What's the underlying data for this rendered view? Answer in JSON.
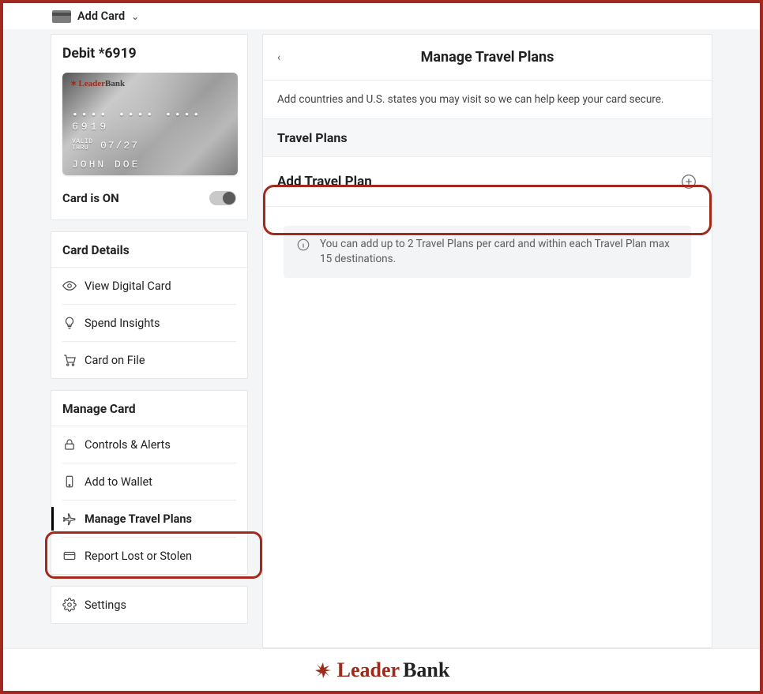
{
  "topbar": {
    "add_card_label": "Add Card"
  },
  "card_summary": {
    "title": "Debit *6919",
    "brand_leader": "Leader",
    "brand_bank": "Bank",
    "pan": "•••• •••• •••• 6919",
    "valid_label_line1": "VALID",
    "valid_label_line2": "THRU",
    "valid_value": "07/27",
    "holder": "JOHN DOE",
    "status_label": "Card is ON"
  },
  "card_details": {
    "heading": "Card Details",
    "items": [
      {
        "label": "View Digital Card",
        "icon": "eye-icon"
      },
      {
        "label": "Spend Insights",
        "icon": "bulb-icon"
      },
      {
        "label": "Card on File",
        "icon": "cart-icon"
      }
    ]
  },
  "manage_card": {
    "heading": "Manage Card",
    "items": [
      {
        "label": "Controls & Alerts",
        "icon": "lock-icon",
        "active": false
      },
      {
        "label": "Add to Wallet",
        "icon": "phone-icon",
        "active": false
      },
      {
        "label": "Manage Travel Plans",
        "icon": "plane-icon",
        "active": true
      },
      {
        "label": "Report Lost or Stolen",
        "icon": "card-alert-icon",
        "active": false
      }
    ]
  },
  "settings_label": "Settings",
  "main": {
    "title": "Manage Travel Plans",
    "description": "Add countries and U.S. states you may visit so we can help keep your card secure.",
    "section_heading": "Travel Plans",
    "add_label": "Add Travel Plan",
    "note": "You can add up to 2 Travel Plans per card and within each Travel Plan max 15 destinations."
  },
  "footer": {
    "brand_leader": "Leader",
    "brand_bank": "Bank"
  },
  "colors": {
    "accent": "#a02a1d"
  }
}
